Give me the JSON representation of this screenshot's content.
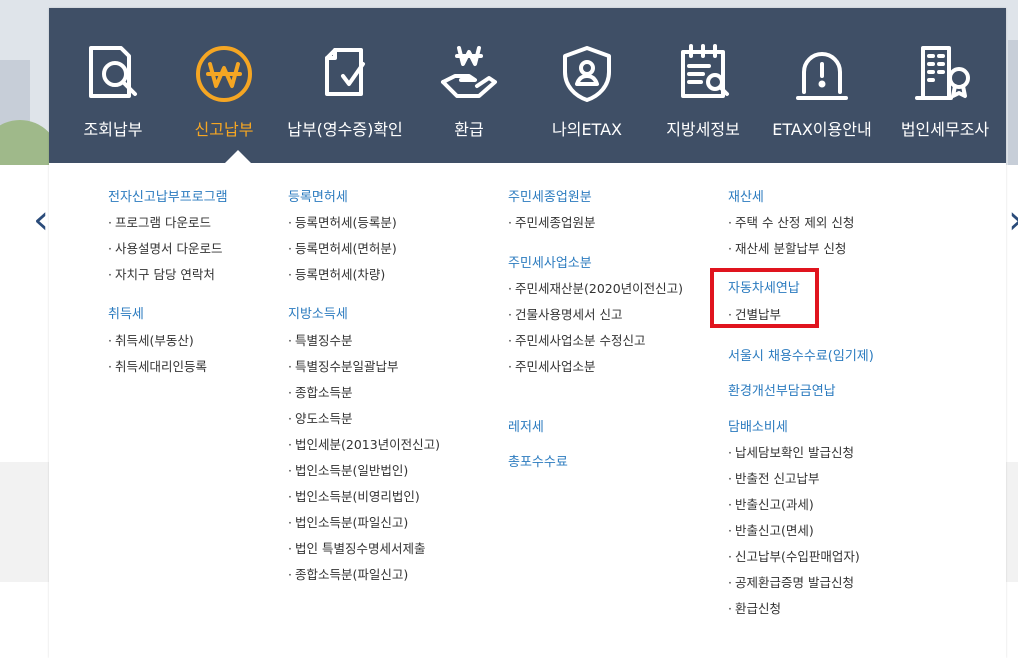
{
  "nav": {
    "items": [
      {
        "label": "조회납부",
        "icon": "search-document-icon"
      },
      {
        "label": "신고납부",
        "icon": "won-coin-icon",
        "active": true
      },
      {
        "label": "납부(영수증)확인",
        "icon": "receipt-check-icon"
      },
      {
        "label": "환급",
        "icon": "refund-hand-icon"
      },
      {
        "label": "나의ETAX",
        "icon": "user-shield-icon"
      },
      {
        "label": "지방세정보",
        "icon": "calendar-search-icon"
      },
      {
        "label": "ETAX이용안내",
        "icon": "alert-bell-icon"
      },
      {
        "label": "법인세무조사",
        "icon": "building-badge-icon"
      }
    ]
  },
  "columns": [
    {
      "sections": [
        {
          "title": "전자신고납부프로그램",
          "items": [
            "프로그램 다운로드",
            "사용설명서 다운로드",
            "자치구 담당 연락처"
          ]
        },
        {
          "title": "취득세",
          "items": [
            "취득세(부동산)",
            "취득세대리인등록"
          ]
        }
      ]
    },
    {
      "sections": [
        {
          "title": "등록면허세",
          "items": [
            "등록면허세(등록분)",
            "등록면허세(면허분)",
            "등록면허세(차량)"
          ]
        },
        {
          "title": "지방소득세",
          "items": [
            "특별징수분",
            "특별징수분일괄납부",
            "종합소득분",
            "양도소득분",
            "법인세분(2013년이전신고)",
            "법인소득분(일반법인)",
            "법인소득분(비영리법인)",
            "법인소득분(파일신고)",
            "법인 특별징수명세서제출",
            "종합소득분(파일신고)"
          ]
        }
      ]
    },
    {
      "sections": [
        {
          "title": "주민세종업원분",
          "items": [
            "주민세종업원분"
          ]
        },
        {
          "title": "주민세사업소분",
          "items": [
            "주민세재산분(2020년이전신고)",
            "건물사용명세서 신고",
            "주민세사업소분 수정신고",
            "주민세사업소분"
          ]
        },
        {
          "title": "레저세",
          "items": []
        },
        {
          "title": "총포수수료",
          "items": []
        }
      ]
    },
    {
      "sections": [
        {
          "title": "재산세",
          "items": [
            "주택 수 산정 제외 신청",
            "재산세 분할납부 신청"
          ]
        },
        {
          "title": "자동차세연납",
          "items": [
            "건별납부"
          ]
        },
        {
          "title": "서울시 채용수수료(임기제)",
          "items": []
        },
        {
          "title": "환경개선부담금연납",
          "items": []
        },
        {
          "title": "담배소비세",
          "items": [
            "납세담보확인 발급신청",
            "반출전 신고납부",
            "반출신고(과세)",
            "반출신고(면세)",
            "신고납부(수입판매업자)",
            "공제환급증명 발급신청",
            "환급신청"
          ]
        }
      ]
    }
  ],
  "colors": {
    "topbar": "#3f4f66",
    "active": "#f5a623",
    "section_title": "#2b7bbf",
    "highlight": "#e0141e"
  }
}
